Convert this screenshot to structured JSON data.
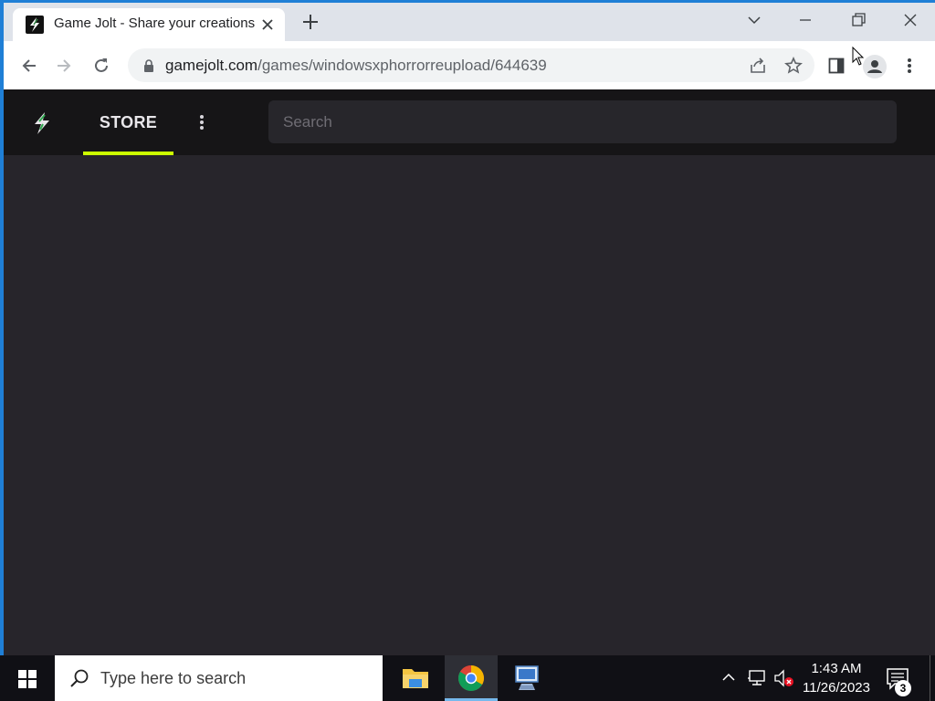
{
  "tab": {
    "title": "Game Jolt - Share your creations",
    "favicon": "game-jolt-favicon"
  },
  "omnibox": {
    "url_host": "gamejolt.com",
    "url_path": "/games/windowsxphorrorreupload/644639"
  },
  "site": {
    "logo": "game-jolt-bolt-logo",
    "nav": {
      "store_label": "STORE"
    },
    "search": {
      "placeholder": "Search"
    },
    "colors": {
      "nav_bg": "#161517",
      "body_bg": "#27252b",
      "accent": "#ccff00"
    }
  },
  "taskbar": {
    "search_placeholder": "Type here to search",
    "pinned_apps": [
      "file-explorer",
      "google-chrome",
      "remote-desktop"
    ],
    "active_app": "google-chrome",
    "clock": {
      "time": "1:43 AM",
      "date": "11/26/2023"
    },
    "notification_count": "3"
  }
}
